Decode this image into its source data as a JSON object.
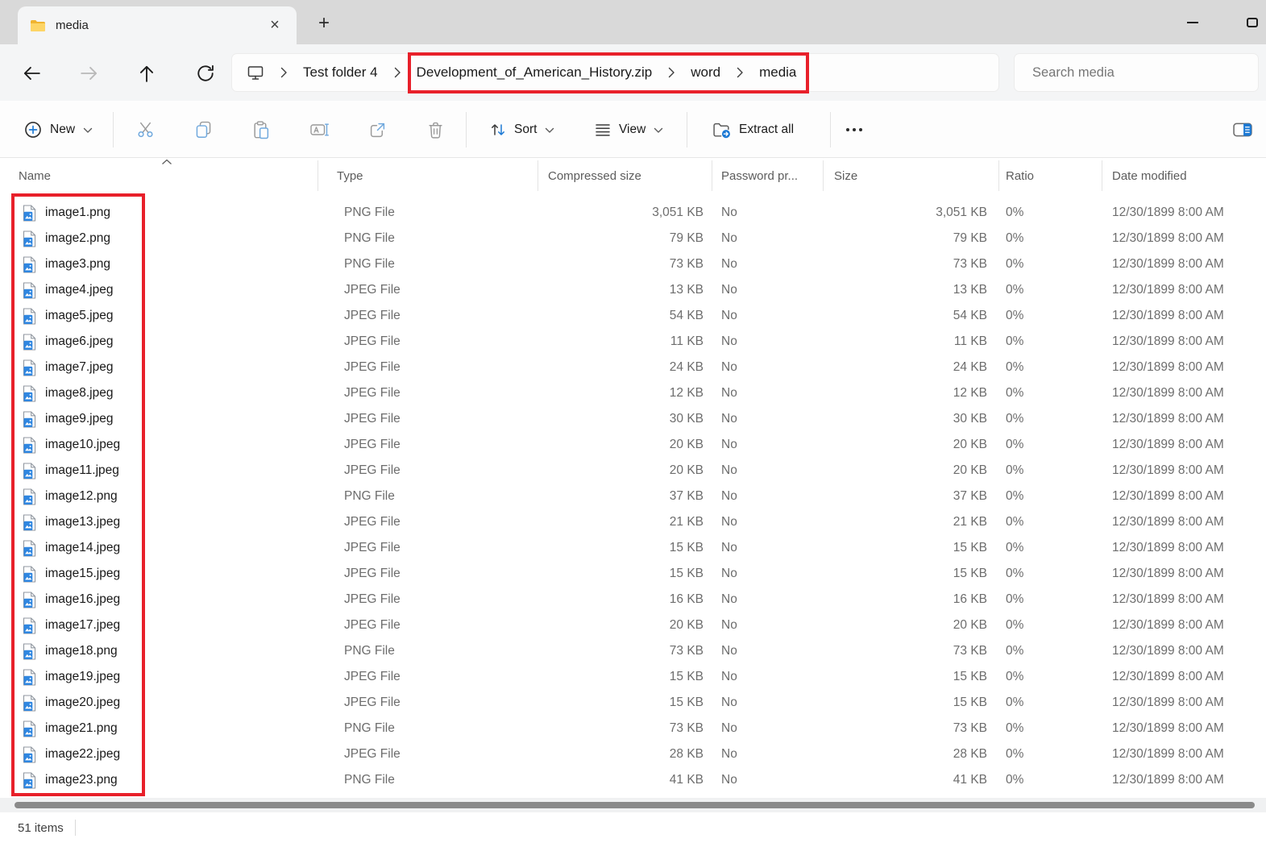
{
  "titlebar": {
    "tab_title": "media"
  },
  "breadcrumb": {
    "segments": [
      "Test folder 4",
      "Development_of_American_History.zip",
      "word",
      "media"
    ]
  },
  "search": {
    "placeholder": "Search media"
  },
  "toolbar": {
    "new": "New",
    "sort": "Sort",
    "view": "View",
    "extract_all": "Extract all"
  },
  "columns": [
    "Name",
    "Type",
    "Compressed size",
    "Password pr...",
    "Size",
    "Ratio",
    "Date modified"
  ],
  "rows": [
    {
      "name": "image1.png",
      "type": "PNG File",
      "compressed": "3,051 KB",
      "password": "No",
      "size": "3,051 KB",
      "ratio": "0%",
      "modified": "12/30/1899 8:00 AM"
    },
    {
      "name": "image2.png",
      "type": "PNG File",
      "compressed": "79 KB",
      "password": "No",
      "size": "79 KB",
      "ratio": "0%",
      "modified": "12/30/1899 8:00 AM"
    },
    {
      "name": "image3.png",
      "type": "PNG File",
      "compressed": "73 KB",
      "password": "No",
      "size": "73 KB",
      "ratio": "0%",
      "modified": "12/30/1899 8:00 AM"
    },
    {
      "name": "image4.jpeg",
      "type": "JPEG File",
      "compressed": "13 KB",
      "password": "No",
      "size": "13 KB",
      "ratio": "0%",
      "modified": "12/30/1899 8:00 AM"
    },
    {
      "name": "image5.jpeg",
      "type": "JPEG File",
      "compressed": "54 KB",
      "password": "No",
      "size": "54 KB",
      "ratio": "0%",
      "modified": "12/30/1899 8:00 AM"
    },
    {
      "name": "image6.jpeg",
      "type": "JPEG File",
      "compressed": "11 KB",
      "password": "No",
      "size": "11 KB",
      "ratio": "0%",
      "modified": "12/30/1899 8:00 AM"
    },
    {
      "name": "image7.jpeg",
      "type": "JPEG File",
      "compressed": "24 KB",
      "password": "No",
      "size": "24 KB",
      "ratio": "0%",
      "modified": "12/30/1899 8:00 AM"
    },
    {
      "name": "image8.jpeg",
      "type": "JPEG File",
      "compressed": "12 KB",
      "password": "No",
      "size": "12 KB",
      "ratio": "0%",
      "modified": "12/30/1899 8:00 AM"
    },
    {
      "name": "image9.jpeg",
      "type": "JPEG File",
      "compressed": "30 KB",
      "password": "No",
      "size": "30 KB",
      "ratio": "0%",
      "modified": "12/30/1899 8:00 AM"
    },
    {
      "name": "image10.jpeg",
      "type": "JPEG File",
      "compressed": "20 KB",
      "password": "No",
      "size": "20 KB",
      "ratio": "0%",
      "modified": "12/30/1899 8:00 AM"
    },
    {
      "name": "image11.jpeg",
      "type": "JPEG File",
      "compressed": "20 KB",
      "password": "No",
      "size": "20 KB",
      "ratio": "0%",
      "modified": "12/30/1899 8:00 AM"
    },
    {
      "name": "image12.png",
      "type": "PNG File",
      "compressed": "37 KB",
      "password": "No",
      "size": "37 KB",
      "ratio": "0%",
      "modified": "12/30/1899 8:00 AM"
    },
    {
      "name": "image13.jpeg",
      "type": "JPEG File",
      "compressed": "21 KB",
      "password": "No",
      "size": "21 KB",
      "ratio": "0%",
      "modified": "12/30/1899 8:00 AM"
    },
    {
      "name": "image14.jpeg",
      "type": "JPEG File",
      "compressed": "15 KB",
      "password": "No",
      "size": "15 KB",
      "ratio": "0%",
      "modified": "12/30/1899 8:00 AM"
    },
    {
      "name": "image15.jpeg",
      "type": "JPEG File",
      "compressed": "15 KB",
      "password": "No",
      "size": "15 KB",
      "ratio": "0%",
      "modified": "12/30/1899 8:00 AM"
    },
    {
      "name": "image16.jpeg",
      "type": "JPEG File",
      "compressed": "16 KB",
      "password": "No",
      "size": "16 KB",
      "ratio": "0%",
      "modified": "12/30/1899 8:00 AM"
    },
    {
      "name": "image17.jpeg",
      "type": "JPEG File",
      "compressed": "20 KB",
      "password": "No",
      "size": "20 KB",
      "ratio": "0%",
      "modified": "12/30/1899 8:00 AM"
    },
    {
      "name": "image18.png",
      "type": "PNG File",
      "compressed": "73 KB",
      "password": "No",
      "size": "73 KB",
      "ratio": "0%",
      "modified": "12/30/1899 8:00 AM"
    },
    {
      "name": "image19.jpeg",
      "type": "JPEG File",
      "compressed": "15 KB",
      "password": "No",
      "size": "15 KB",
      "ratio": "0%",
      "modified": "12/30/1899 8:00 AM"
    },
    {
      "name": "image20.jpeg",
      "type": "JPEG File",
      "compressed": "15 KB",
      "password": "No",
      "size": "15 KB",
      "ratio": "0%",
      "modified": "12/30/1899 8:00 AM"
    },
    {
      "name": "image21.png",
      "type": "PNG File",
      "compressed": "73 KB",
      "password": "No",
      "size": "73 KB",
      "ratio": "0%",
      "modified": "12/30/1899 8:00 AM"
    },
    {
      "name": "image22.jpeg",
      "type": "JPEG File",
      "compressed": "28 KB",
      "password": "No",
      "size": "28 KB",
      "ratio": "0%",
      "modified": "12/30/1899 8:00 AM"
    },
    {
      "name": "image23.png",
      "type": "PNG File",
      "compressed": "41 KB",
      "password": "No",
      "size": "41 KB",
      "ratio": "0%",
      "modified": "12/30/1899 8:00 AM"
    }
  ],
  "statusbar": {
    "items_count": "51 items"
  },
  "colors": {
    "annotation_red": "#e8202a",
    "accent_blue": "#1c79d4",
    "folder_yellow": "#fdd566",
    "file_icon_blue": "#2f86e0"
  }
}
